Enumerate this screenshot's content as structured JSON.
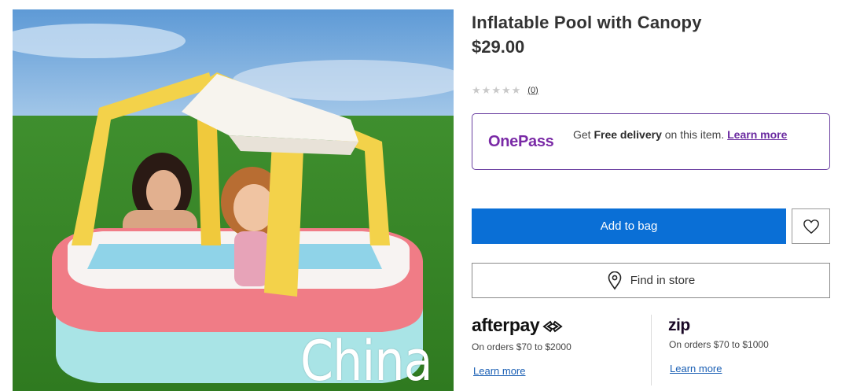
{
  "product": {
    "title": "Inflatable Pool with Canopy",
    "price": "$29.00",
    "rating_count": "(0)",
    "stars": 0,
    "max_stars": 5
  },
  "onepass": {
    "logo": "OnePass",
    "text_prefix": "Get ",
    "text_bold": "Free delivery",
    "text_suffix": " on this item. ",
    "link": "Learn more"
  },
  "actions": {
    "add_to_bag": "Add to bag",
    "find_in_store": "Find in store",
    "wishlist_icon": "heart-icon",
    "store_icon": "location-pin-icon"
  },
  "payments": {
    "afterpay": {
      "logo": "afterpay",
      "terms": "On orders $70 to $2000",
      "link": "Learn more"
    },
    "zip": {
      "logo": "zip",
      "terms": "On orders $70 to $1000",
      "link": "Learn more"
    }
  },
  "watermark": "China",
  "colors": {
    "primary_button": "#0a6fd6",
    "onepass_purple": "#7a2aa6",
    "link_blue": "#1a5fb4"
  }
}
